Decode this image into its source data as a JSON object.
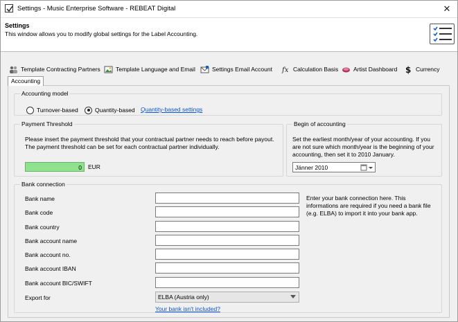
{
  "window": {
    "title": "Settings - Music Enterprise Software - REBEAT Digital",
    "close_glyph": "✕"
  },
  "header": {
    "title": "Settings",
    "subtitle": "This window allows you to modify global settings for the Label Accounting."
  },
  "tabs": [
    {
      "label": "Template Contracting Partners",
      "icon": "users-icon"
    },
    {
      "label": "Template Language and Email",
      "icon": "image-icon"
    },
    {
      "label": "Settings Email Account",
      "icon": "email-account-icon"
    },
    {
      "label": "Calculation Basis",
      "icon": "function-icon"
    },
    {
      "label": "Artist Dashboard",
      "icon": "dashboard-icon"
    },
    {
      "label": "Currency",
      "icon": "dollar-icon"
    }
  ],
  "active_tab": "Accounting",
  "accounting_model": {
    "label": "Accounting model",
    "options": [
      "Turnover-based",
      "Quantity-based"
    ],
    "selected": "Quantity-based",
    "link": "Quantity-based settings"
  },
  "payment_threshold": {
    "label": "Payment Threshold",
    "description1": "Please insert the payment threshold that your contractual partner needs to reach before payout.",
    "description2": "The payment threshold can be set for each contractual partner individually.",
    "value": "0",
    "currency": "EUR",
    "field_color": "#8fe38f"
  },
  "begin_accounting": {
    "label": "Begin of accounting",
    "description": "Set the earliest month/year of your accounting. If you are not sure which month/year is the beginning of your accounting, then set it to 2010 January.",
    "value": "Jänner 2010"
  },
  "bank": {
    "label": "Bank connection",
    "fields": [
      {
        "label": "Bank name",
        "value": ""
      },
      {
        "label": "Bank code",
        "value": ""
      },
      {
        "label": "Bank country",
        "value": ""
      },
      {
        "label": "Bank account name",
        "value": ""
      },
      {
        "label": "Bank account no.",
        "value": ""
      },
      {
        "label": "Bank account IBAN",
        "value": ""
      },
      {
        "label": "Bank account BIC/SWIFT",
        "value": ""
      }
    ],
    "export_label": "Export for",
    "export_value": "ELBA (Austria only)",
    "help": "Enter your bank connection here. This informations are required if you need a bank file (e.g. ELBA) to import it into your bank app.",
    "link": "Your bank isn't included?"
  },
  "colors": {
    "link": "#0b55d5",
    "panel": "#f0f0f0"
  }
}
